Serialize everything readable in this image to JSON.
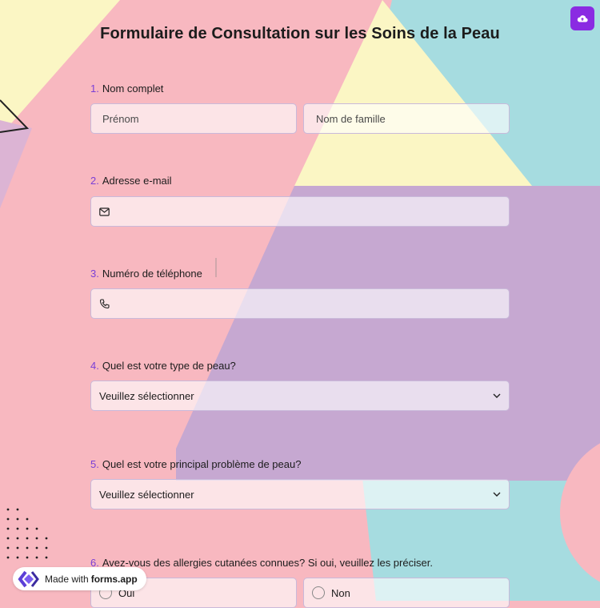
{
  "form": {
    "title": "Formulaire de Consultation sur les Soins de la Peau"
  },
  "questions": [
    {
      "number": "1.",
      "label": "Nom complet",
      "first_placeholder": "Prénom",
      "last_placeholder": "Nom de famille"
    },
    {
      "number": "2.",
      "label": "Adresse e-mail"
    },
    {
      "number": "3.",
      "label": "Numéro de téléphone"
    },
    {
      "number": "4.",
      "label": "Quel est votre type de peau?",
      "selected": "Veuillez sélectionner"
    },
    {
      "number": "5.",
      "label": "Quel est votre principal problème de peau?",
      "selected": "Veuillez sélectionner"
    },
    {
      "number": "6.",
      "label": "Avez-vous des allergies cutanées connues? Si oui, veuillez les préciser.",
      "options": [
        "Oui",
        "Non"
      ]
    }
  ],
  "footer": {
    "made_with": "Made with",
    "brand": "forms.app"
  },
  "icons": [
    "cloud-upload-icon",
    "mail-icon",
    "phone-icon",
    "chevron-down-icon",
    "forms-app-logo-icon"
  ],
  "colors": {
    "accent": "#8a2be2",
    "pink": "#f8b8c0",
    "yellow": "#fbf6c4",
    "teal": "#a6dce0",
    "purple": "#c6a8d1"
  }
}
